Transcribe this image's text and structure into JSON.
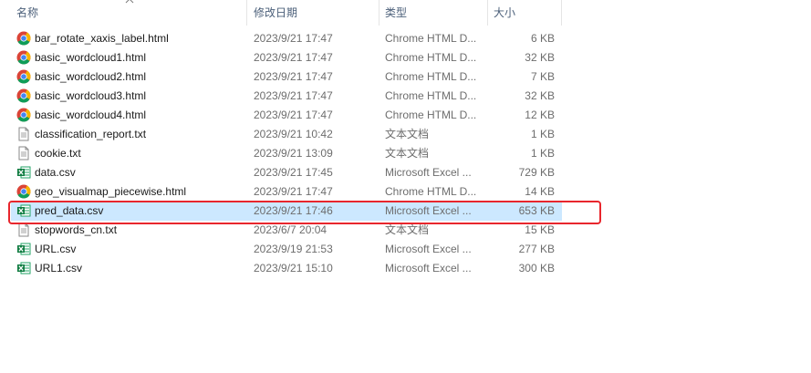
{
  "columns": {
    "name": "名称",
    "date": "修改日期",
    "type": "类型",
    "size": "大小"
  },
  "files": [
    {
      "name": "bar_rotate_xaxis_label.html",
      "date": "2023/9/21 17:47",
      "type": "Chrome HTML D...",
      "size": "6 KB",
      "icon": "chrome-icon"
    },
    {
      "name": "basic_wordcloud1.html",
      "date": "2023/9/21 17:47",
      "type": "Chrome HTML D...",
      "size": "32 KB",
      "icon": "chrome-icon"
    },
    {
      "name": "basic_wordcloud2.html",
      "date": "2023/9/21 17:47",
      "type": "Chrome HTML D...",
      "size": "7 KB",
      "icon": "chrome-icon"
    },
    {
      "name": "basic_wordcloud3.html",
      "date": "2023/9/21 17:47",
      "type": "Chrome HTML D...",
      "size": "32 KB",
      "icon": "chrome-icon"
    },
    {
      "name": "basic_wordcloud4.html",
      "date": "2023/9/21 17:47",
      "type": "Chrome HTML D...",
      "size": "12 KB",
      "icon": "chrome-icon"
    },
    {
      "name": "classification_report.txt",
      "date": "2023/9/21 10:42",
      "type": "文本文档",
      "size": "1 KB",
      "icon": "text-file-icon"
    },
    {
      "name": "cookie.txt",
      "date": "2023/9/21 13:09",
      "type": "文本文档",
      "size": "1 KB",
      "icon": "text-file-icon"
    },
    {
      "name": "data.csv",
      "date": "2023/9/21 17:45",
      "type": "Microsoft Excel ...",
      "size": "729 KB",
      "icon": "excel-icon"
    },
    {
      "name": "geo_visualmap_piecewise.html",
      "date": "2023/9/21 17:47",
      "type": "Chrome HTML D...",
      "size": "14 KB",
      "icon": "chrome-icon"
    },
    {
      "name": "pred_data.csv",
      "date": "2023/9/21 17:46",
      "type": "Microsoft Excel ...",
      "size": "653 KB",
      "icon": "excel-icon",
      "selected": true
    },
    {
      "name": "stopwords_cn.txt",
      "date": "2023/6/7 20:04",
      "type": "文本文档",
      "size": "15 KB",
      "icon": "text-file-icon"
    },
    {
      "name": "URL.csv",
      "date": "2023/9/19 21:53",
      "type": "Microsoft Excel ...",
      "size": "277 KB",
      "icon": "excel-icon"
    },
    {
      "name": "URL1.csv",
      "date": "2023/9/21 15:10",
      "type": "Microsoft Excel ...",
      "size": "300 KB",
      "icon": "excel-icon"
    }
  ],
  "colors": {
    "selection": "#cce8ff",
    "highlight_border": "#e8262d",
    "header_text": "#4c607a",
    "secondary_text": "#6d6d6d"
  }
}
